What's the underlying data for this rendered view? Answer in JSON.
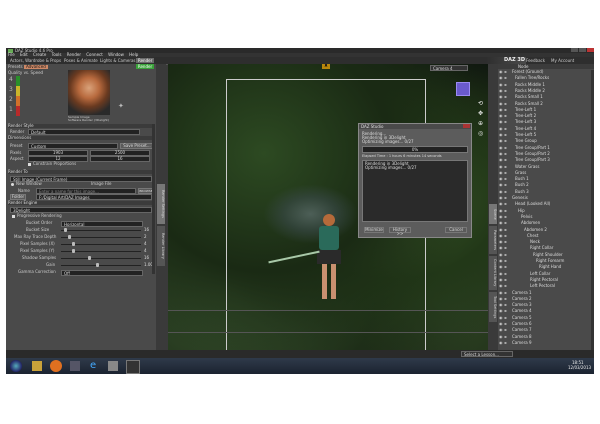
{
  "app": {
    "title": "DAZ Studio 4.6 Pro",
    "menu": [
      "File",
      "Edit",
      "Create",
      "Tools",
      "Render",
      "Connect",
      "Window",
      "Help"
    ]
  },
  "tabs": [
    "Actors, Wardrobe & Props",
    "Poses & Animate",
    "Lights & Cameras",
    "Render"
  ],
  "header": {
    "logo": "DAZ 3D",
    "links": [
      "Feedback",
      "My Account"
    ]
  },
  "left": {
    "preset_tabs": [
      "Presets",
      "Advanced"
    ],
    "render_label": "Render",
    "quality_label": "Quality vs. Speed",
    "quality_levels": [
      "4",
      "3",
      "2",
      "1"
    ],
    "sample_caption": "Sample Image\nSoftware Render (3Delight)",
    "render_style_hdr": "Render Style",
    "render_style_label": "Render",
    "render_style_value": "Default",
    "dimensions_hdr": "Dimensions",
    "preset_label": "Preset",
    "preset_value": "Custom",
    "save_preset": "Save Preset...",
    "pixels_label": "Pixels",
    "pixels_w": "1903",
    "pixels_h": "2500",
    "aspect_label": "Aspect",
    "aspect_w": "12",
    "aspect_h": "16",
    "constrain": "Constrain Proportions",
    "render_to_hdr": "Render To",
    "render_to_value": "Still Image (Current Frame)",
    "new_window": "New Window",
    "image_file": "Image File",
    "name_label": "Name",
    "name_placeholder": "Enter a name for this image...",
    "name_btn": "BROWSE",
    "folder_label": "Folder",
    "folder_value": "F:/Digital Art/DAZ Images",
    "engine_hdr": "Render Engine",
    "engine_value": "3Delight",
    "progressive": "Progressive Rendering",
    "params": [
      {
        "label": "Bucket Order",
        "value": "Horizontal"
      },
      {
        "label": "Bucket Size",
        "value": "16"
      },
      {
        "label": "Max Ray Trace Depth",
        "value": "2"
      },
      {
        "label": "Pixel Samples (X)",
        "value": "4"
      },
      {
        "label": "Pixel Samples (Y)",
        "value": "4"
      },
      {
        "label": "Shadow Samples",
        "value": "16"
      },
      {
        "label": "Gain",
        "value": "1.00"
      },
      {
        "label": "Gamma Correction",
        "value": "Off"
      }
    ]
  },
  "vtabs": [
    "Render Settings",
    "Render Library"
  ],
  "viewport": {
    "camera": "Camera 4"
  },
  "dialog": {
    "title": "DAZ Studio",
    "line1": "Rendering...",
    "line2": "Rendering in 3Delight",
    "line3": "Optimizing images... 0/27",
    "progress_pct": "0%",
    "elapsed": "Elapsed Time : 1 hours 6 minutes 14 seconds",
    "log": [
      "Rendering in 3Delight",
      "Optimizing images... 0/27"
    ],
    "buttons": [
      "Minimize",
      "History >>",
      "Cancel"
    ]
  },
  "right": {
    "vtabs": [
      "Scene",
      "Parameters",
      "Content Library",
      "Tool Settings"
    ],
    "header": "Node",
    "items": [
      "Forest (Ground)",
      "Fallen Tree/Rocks",
      "Rocks Middle 1",
      "Rocks Middle 2",
      "Rocks Small 1",
      "Rocks Small 2",
      "Tree-Left 1",
      "Tree-Left 2",
      "Tree-Left 3",
      "Tree-Left 4",
      "Tree-Left 5",
      "Tree Group",
      "Tree Group/Part 1",
      "Tree Group/Part 2",
      "Tree Group/Part 3",
      "Water Grass",
      "Grass",
      "Bush 1",
      "Bush 2",
      "Bush 3",
      "Genesis",
      "Head (Looked All)",
      "Hip",
      "Pelvis",
      "Abdomen",
      "Abdomen 2",
      "Chest",
      "Neck",
      "Right Collar",
      "Right Shoulder",
      "Right Forearm",
      "Right Hand",
      "Left Collar",
      "Right Pectoral",
      "Left Pectoral",
      "Camera 1",
      "Camera 2",
      "Camera 3",
      "Camera 4",
      "Camera 5",
      "Camera 6",
      "Camera 7",
      "Camera 8",
      "Camera 9"
    ]
  },
  "status": {
    "select_lesson": "Select a Lesson..."
  },
  "taskbar": {
    "time": "18:51",
    "date": "12/03/2013"
  },
  "colors": {
    "accent_green": "#3aa33a",
    "dialog_bg": "#5c5c5c",
    "panel_bg": "#4a4a4a"
  }
}
